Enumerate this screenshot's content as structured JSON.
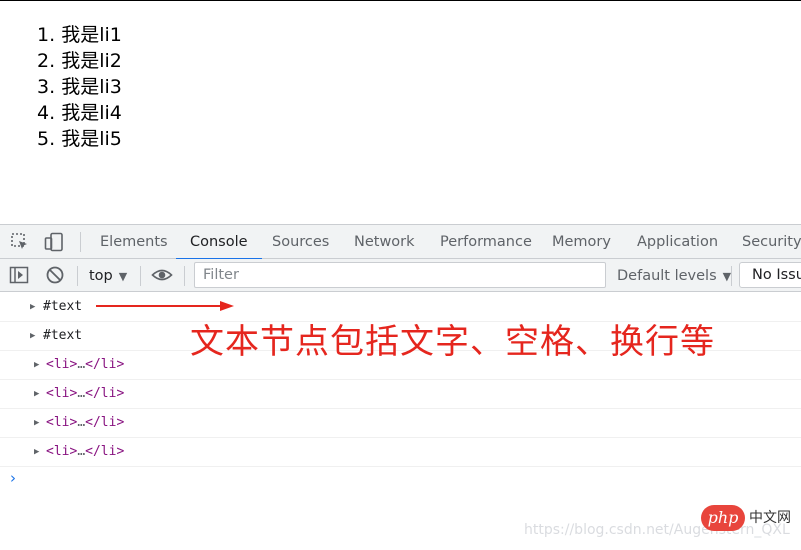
{
  "page": {
    "list": [
      {
        "num": "1.",
        "text": "我是li1"
      },
      {
        "num": "2.",
        "text": "我是li2"
      },
      {
        "num": "3.",
        "text": "我是li3"
      },
      {
        "num": "4.",
        "text": "我是li4"
      },
      {
        "num": "5.",
        "text": "我是li5"
      }
    ]
  },
  "devtools": {
    "tabs": {
      "elements": "Elements",
      "console": "Console",
      "sources": "Sources",
      "network": "Network",
      "performance": "Performance",
      "memory": "Memory",
      "application": "Application",
      "security": "Security"
    },
    "active_tab": "Console",
    "toolbar": {
      "context": "top",
      "filter_placeholder": "Filter",
      "levels": "Default levels",
      "issues": "No Issues"
    },
    "console_rows": [
      {
        "text": "#text"
      },
      {
        "text": "#text"
      },
      {
        "open": "<li>",
        "ellipsis": "…",
        "close": "</li>"
      },
      {
        "open": "<li>",
        "ellipsis": "…",
        "close": "</li>"
      },
      {
        "open": "<li>",
        "ellipsis": "…",
        "close": "</li>"
      },
      {
        "open": "<li>",
        "ellipsis": "…",
        "close": "</li>"
      }
    ],
    "prompt_symbol": "›",
    "accent_color": "#1a73e8"
  },
  "annotation": {
    "text": "文本节点包括文字、空格、换行等",
    "color": "#e5261e"
  },
  "watermark": {
    "url": "https://blog.csdn.net/Augenstern_QXL",
    "logo": "php",
    "logo_cn": "中文网"
  }
}
